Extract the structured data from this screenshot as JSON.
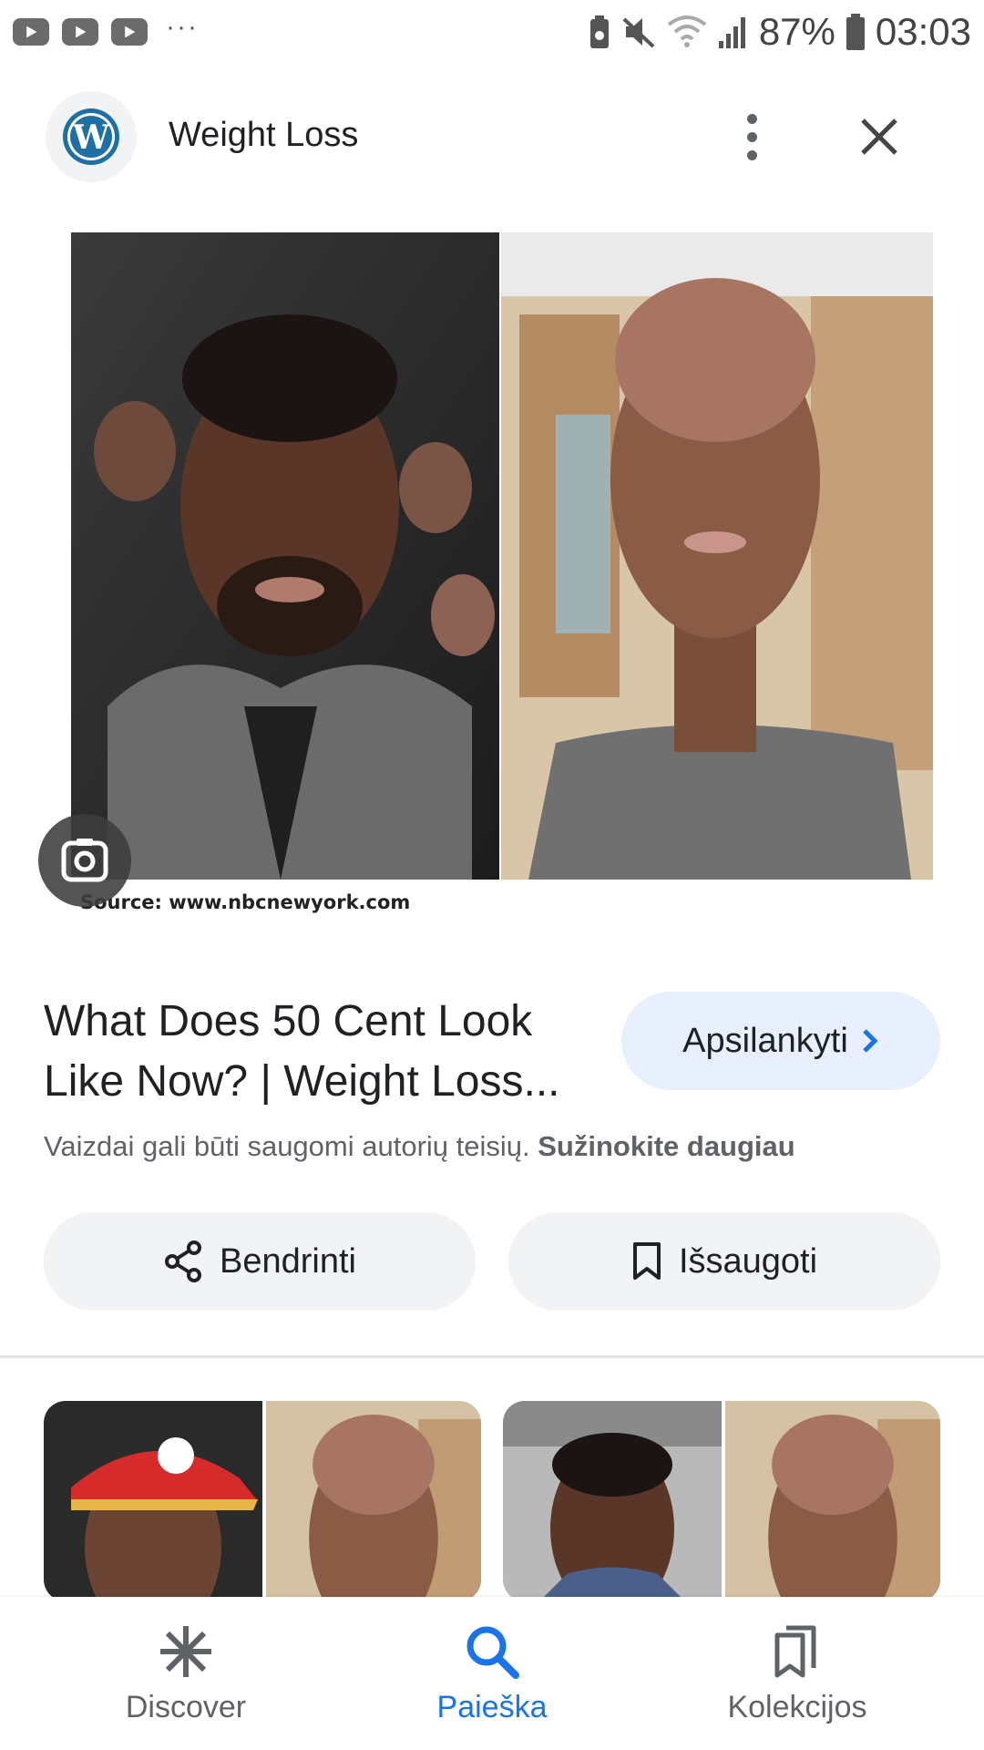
{
  "status_bar": {
    "battery": "87%",
    "time": "03:03",
    "overflow": "···"
  },
  "header": {
    "title": "Weight Loss",
    "logo_icon": "wordpress-icon"
  },
  "image": {
    "source_caption": "Source: www.nbcnewyork.com"
  },
  "result": {
    "title": "What Does 50 Cent Look Like Now? | Weight Loss...",
    "visit_label": "Apsilankyti",
    "copyright_text": "Vaizdai gali būti saugomi autorių teisių.",
    "learn_more": "Sužinokite daugiau"
  },
  "actions": {
    "share_label": "Bendrinti",
    "save_label": "Išsaugoti"
  },
  "nav": {
    "discover": "Discover",
    "search": "Paieška",
    "collections": "Kolekcijos",
    "active": "search"
  },
  "colors": {
    "accent": "#1a73e8",
    "visit_bg": "#e8f0fe",
    "chip_bg": "#f1f3f4"
  }
}
